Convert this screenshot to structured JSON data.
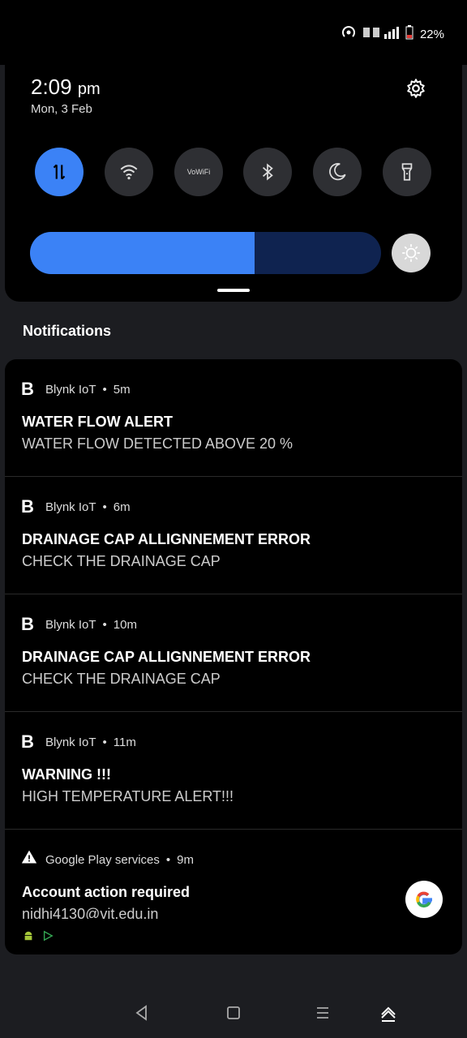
{
  "status": {
    "battery_pct": "22%"
  },
  "quick_settings": {
    "time": "2:09",
    "ampm": "pm",
    "date": "Mon, 3 Feb",
    "vowifi_label": "VoWiFi",
    "brightness_level": 0.64,
    "accent": "#3b82f6"
  },
  "notifications_header": "Notifications",
  "notifications": [
    {
      "app": "Blynk IoT",
      "time": "5m",
      "title": "WATER FLOW ALERT",
      "message": "WATER FLOW DETECTED ABOVE 20 %"
    },
    {
      "app": "Blynk IoT",
      "time": "6m",
      "title": "DRAINAGE CAP ALLIGNNEMENT ERROR",
      "message": "CHECK THE DRAINAGE CAP"
    },
    {
      "app": "Blynk IoT",
      "time": "10m",
      "title": "DRAINAGE CAP ALLIGNNEMENT ERROR",
      "message": "CHECK THE DRAINAGE CAP"
    },
    {
      "app": "Blynk IoT",
      "time": "11m",
      "title": "WARNING !!!",
      "message": "HIGH TEMPERATURE ALERT!!!"
    },
    {
      "app": "Google Play services",
      "time": "9m",
      "title": "Account action required",
      "message": "nidhi4130@vit.edu.in"
    }
  ],
  "app_logo_letter": "B",
  "separator": "•",
  "icons": [
    "hotspot-icon",
    "signal-icon",
    "battery-icon",
    "settings-icon",
    "data-toggle-icon",
    "wifi-icon",
    "bluetooth-icon",
    "moon-icon",
    "flashlight-icon",
    "auto-brightness-icon",
    "warning-icon",
    "google-icon",
    "android-icon",
    "play-icon",
    "back-icon",
    "home-icon",
    "recents-icon",
    "hide-nav-icon"
  ]
}
